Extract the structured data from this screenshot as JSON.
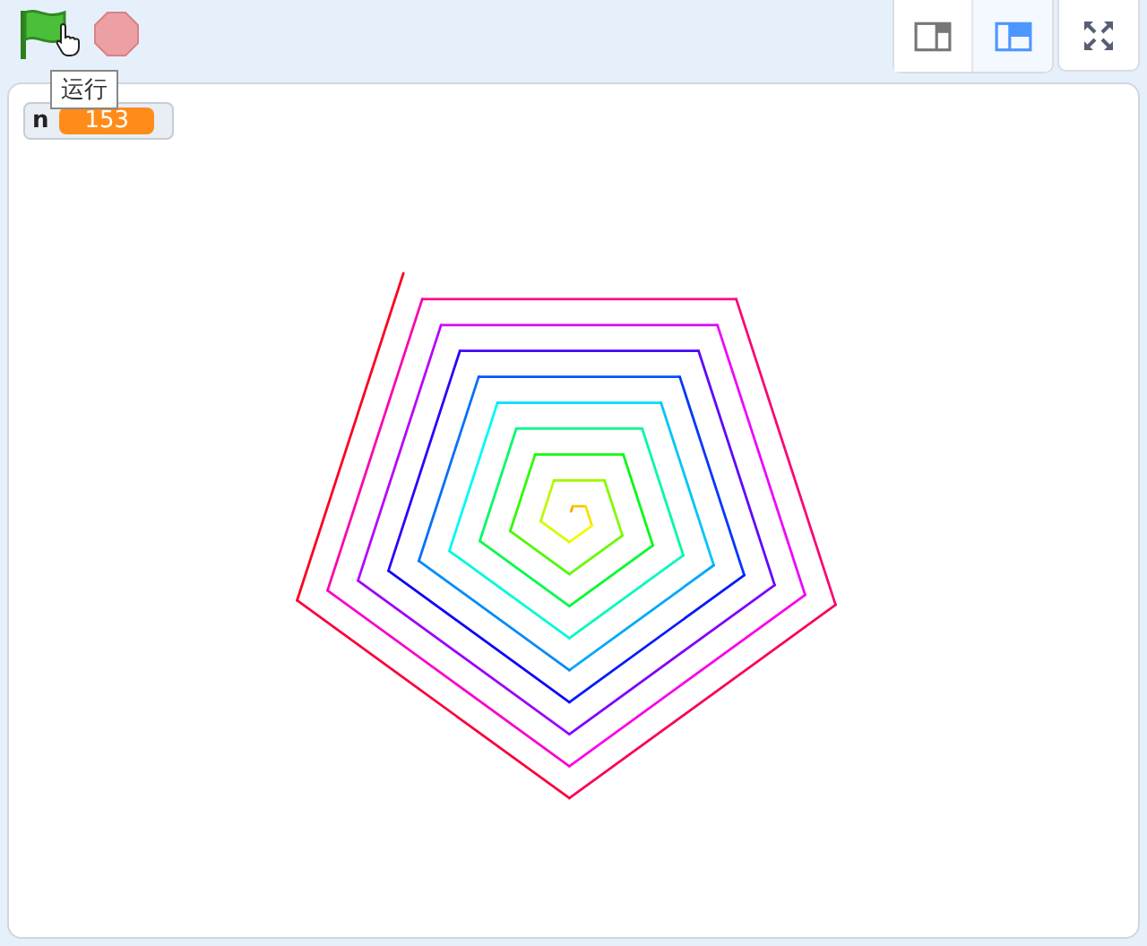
{
  "toolbar": {
    "tooltip": "运行"
  },
  "monitor": {
    "label": "n",
    "value": "153"
  },
  "layout_buttons": [
    {
      "selected": false
    },
    {
      "selected": true
    }
  ]
}
